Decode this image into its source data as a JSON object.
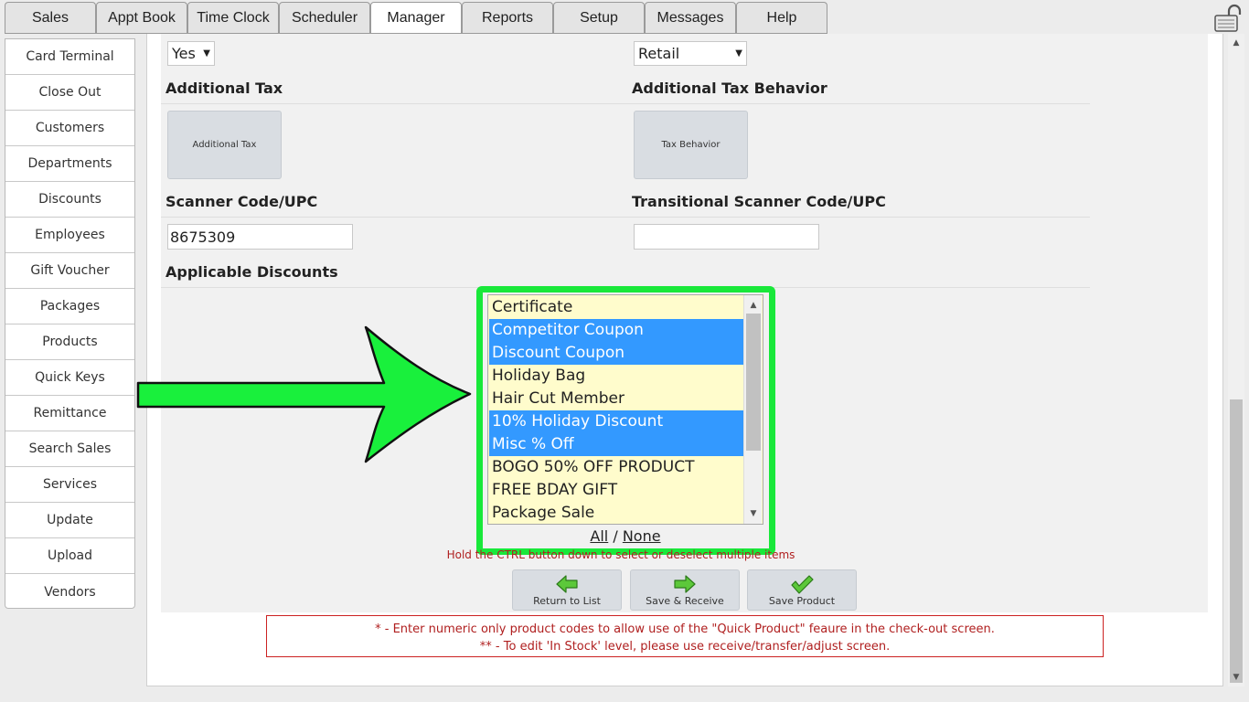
{
  "tabs": [
    {
      "label": "Sales"
    },
    {
      "label": "Appt Book"
    },
    {
      "label": "Time Clock"
    },
    {
      "label": "Scheduler"
    },
    {
      "label": "Manager"
    },
    {
      "label": "Reports"
    },
    {
      "label": "Setup"
    },
    {
      "label": "Messages"
    },
    {
      "label": "Help"
    }
  ],
  "active_tab": "Manager",
  "sidebar": {
    "items": [
      {
        "label": "Card Terminal"
      },
      {
        "label": "Close Out"
      },
      {
        "label": "Customers"
      },
      {
        "label": "Departments"
      },
      {
        "label": "Discounts"
      },
      {
        "label": "Employees"
      },
      {
        "label": "Gift Voucher"
      },
      {
        "label": "Packages"
      },
      {
        "label": "Products"
      },
      {
        "label": "Quick Keys"
      },
      {
        "label": "Remittance"
      },
      {
        "label": "Search Sales"
      },
      {
        "label": "Services"
      },
      {
        "label": "Update"
      },
      {
        "label": "Upload"
      },
      {
        "label": "Vendors"
      }
    ]
  },
  "form": {
    "top_left_select": {
      "value": "Yes"
    },
    "top_right_select": {
      "value": "Retail"
    },
    "additional_tax": {
      "heading": "Additional Tax",
      "button_label": "Additional Tax"
    },
    "tax_behavior": {
      "heading": "Additional Tax Behavior",
      "button_label": "Tax Behavior"
    },
    "scanner_code": {
      "heading": "Scanner Code/UPC",
      "value": "8675309"
    },
    "transitional_scanner_code": {
      "heading": "Transitional Scanner Code/UPC",
      "value": ""
    },
    "applicable_discounts": {
      "heading": "Applicable Discounts",
      "options": [
        {
          "label": "Certificate",
          "selected": false
        },
        {
          "label": "Competitor Coupon",
          "selected": true
        },
        {
          "label": "Discount Coupon",
          "selected": true
        },
        {
          "label": "Holiday Bag",
          "selected": false
        },
        {
          "label": "Hair Cut Member",
          "selected": false
        },
        {
          "label": "10% Holiday Discount",
          "selected": true
        },
        {
          "label": "Misc % Off",
          "selected": true
        },
        {
          "label": "BOGO 50% OFF PRODUCT",
          "selected": false
        },
        {
          "label": "FREE BDAY GIFT",
          "selected": false
        },
        {
          "label": "Package Sale",
          "selected": false
        }
      ],
      "all_label": "All",
      "separator": "/",
      "none_label": "None",
      "hint": "Hold the CTRL button down to select or deselect multiple items"
    }
  },
  "actions": {
    "return_label": "Return to List",
    "save_receive_label": "Save & Receive",
    "save_product_label": "Save Product"
  },
  "notes": {
    "line1": "* - Enter numeric only product codes to allow use of the \"Quick Product\" feaure in the check-out screen.",
    "line2": "** - To edit 'In Stock' level, please use receive/transfer/adjust screen."
  },
  "colors": {
    "highlight_frame": "#19e83a",
    "selected_option": "#3399ff",
    "listbox_bg": "#fffccc",
    "notes_red": "#b02020"
  },
  "icons": {
    "pointer_arrow": "green-arrow-icon",
    "lock": "lock-icon",
    "return": "back-arrow-icon",
    "save_receive": "forward-arrow-icon",
    "save": "checkmark-icon"
  }
}
